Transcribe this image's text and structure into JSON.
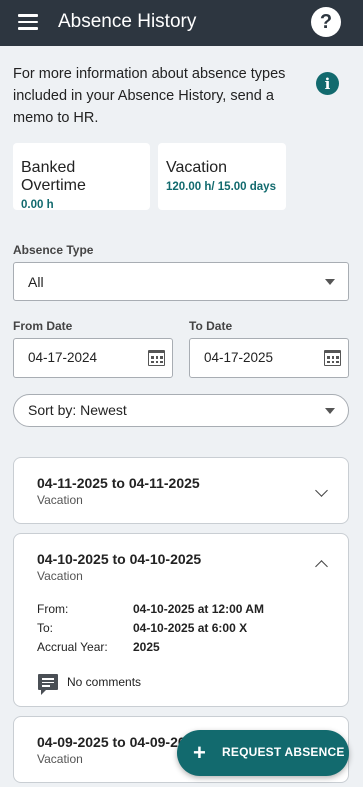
{
  "app": {
    "title": "Absence History",
    "help_label": "?"
  },
  "info": {
    "text": "For more information about absence types included in your Absence History, send a memo to HR.",
    "icon": "info-icon",
    "icon_glyph": "i",
    "icon_color": "#126a6e"
  },
  "balances": [
    {
      "label": "Banked Overtime",
      "value": "0.00 h"
    },
    {
      "label": "Vacation",
      "value": "120.00 h/ 15.00 days"
    }
  ],
  "filters": {
    "absence_type": {
      "label": "Absence Type",
      "value": "All"
    },
    "from_date": {
      "label": "From Date",
      "value": "04-17-2024"
    },
    "to_date": {
      "label": "To Date",
      "value": "04-17-2025"
    },
    "sort": {
      "value": "Sort by: Newest"
    }
  },
  "absences": [
    {
      "range": "04-11-2025 to 04-11-2025",
      "type": "Vacation",
      "expanded": false
    },
    {
      "range": "04-10-2025 to 04-10-2025",
      "type": "Vacation",
      "expanded": true,
      "details": {
        "from_label": "From:",
        "from_value": "04-10-2025 at 12:00 AM",
        "to_label": "To:",
        "to_value": "04-10-2025 at 6:00 X",
        "accrual_label": "Accrual Year:",
        "accrual_value": "2025",
        "comments": "No comments"
      }
    },
    {
      "range": "04-09-2025 to 04-09-20",
      "type": "Vacation",
      "expanded": false
    }
  ],
  "fab": {
    "label": "REQUEST ABSENCE",
    "plus": "+"
  },
  "colors": {
    "accent": "#126a6e",
    "appbar": "#2d3640",
    "background": "#eef1f4"
  }
}
